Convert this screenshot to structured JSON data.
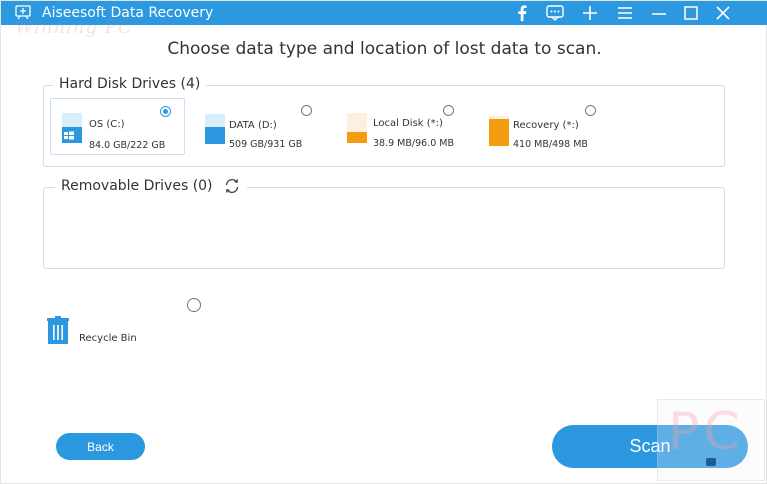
{
  "window": {
    "title": "Aiseesoft Data Recovery",
    "accent_color": "#2b98e0",
    "watermark_text": "Winning PC",
    "controls": [
      "facebook-icon",
      "feedback-icon",
      "plus-icon",
      "menu-icon",
      "minimize-icon",
      "maximize-icon",
      "close-icon"
    ]
  },
  "heading": "Choose data type and location of lost data to scan.",
  "hard_disk_drives": {
    "label": "Hard Disk Drives (4)",
    "drives": [
      {
        "name": "OS (C:)",
        "size": "84.0 GB/222 GB",
        "selected": true,
        "icon": "windows-drive-icon",
        "color": "#2b98e0"
      },
      {
        "name": "DATA (D:)",
        "size": "509 GB/931 GB",
        "selected": false,
        "icon": "drive-icon",
        "color": "#2b98e0"
      },
      {
        "name": "Local Disk (*:)",
        "size": "38.9 MB/96.0 MB",
        "selected": false,
        "icon": "drive-icon",
        "color": "#f39c12"
      },
      {
        "name": "Recovery (*:)",
        "size": "410 MB/498 MB",
        "selected": false,
        "icon": "drive-icon",
        "color": "#f39c12"
      }
    ]
  },
  "removable_drives": {
    "label": "Removable Drives (0)",
    "refresh_icon": "refresh-icon"
  },
  "recycle_bin": {
    "label": "Recycle Bin",
    "selected": false
  },
  "buttons": {
    "back": "Back",
    "scan": "Scan"
  },
  "corner_watermark": "PC"
}
